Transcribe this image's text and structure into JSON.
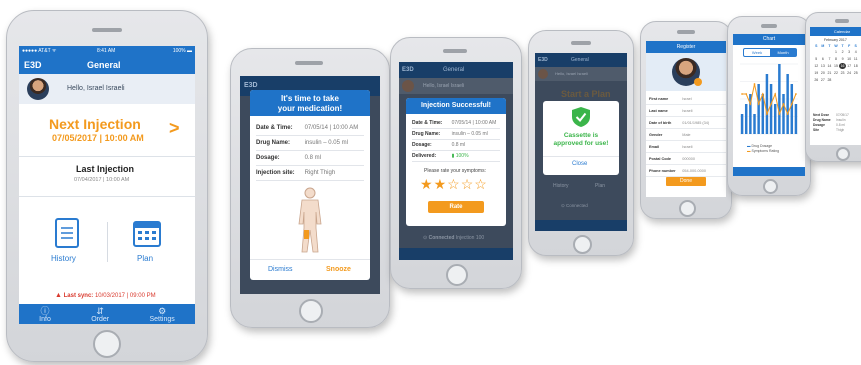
{
  "phone1": {
    "status": {
      "carrier": "●●●●● AT&T ᯤ",
      "time": "8:41 AM",
      "battery": "100% ▬"
    },
    "brand": "E3D",
    "title": "General",
    "greeting": "Hello, Israel Israeli",
    "next_label": "Next Injection",
    "next_datetime": "07/05/2017 | 10:00 AM",
    "last_label": "Last Injection",
    "last_datetime": "07/04/2017 | 10:00 AM",
    "history_label": "History",
    "plan_label": "Plan",
    "sync_label": "Last sync:",
    "sync_value": "10/03/2017 | 09:00 PM",
    "tabs": [
      "Info",
      "Order",
      "Settings"
    ]
  },
  "phone2": {
    "brand": "E3D",
    "title_line1": "It's time to take",
    "title_line2": "your medication!",
    "rows": [
      {
        "label": "Date & Time:",
        "value": "07/05/14 | 10:00 AM"
      },
      {
        "label": "Drug Name:",
        "value": "insulin – 0.05 ml"
      },
      {
        "label": "Dosage:",
        "value": "0.8 ml"
      },
      {
        "label": "Injection site:",
        "value": "Right Thigh"
      }
    ],
    "dismiss": "Dismiss",
    "snooze": "Snooze"
  },
  "phone3": {
    "brand": "E3D",
    "title": "General",
    "greeting": "Hello, Israel Israeli",
    "modal_title": "Injection Successful!",
    "rows": [
      {
        "label": "Date & Time:",
        "value": "07/05/14 | 10:00 AM"
      },
      {
        "label": "Drug Name:",
        "value": "insulin – 0.05 ml"
      },
      {
        "label": "Dosage:",
        "value": "0.8 ml"
      },
      {
        "label": "Delivered:",
        "value": "100%"
      }
    ],
    "rate_prompt": "Please rate your symptoms:",
    "rating": 2,
    "rating_max": 5,
    "rate_button": "Rate",
    "connected": "Connected",
    "connected_detail": "Injection 100"
  },
  "phone4": {
    "brand": "E3D",
    "title": "General",
    "greeting": "Hello, Israel Israeli",
    "bg_text": "Start a Plan",
    "modal_line1": "Cassette is",
    "modal_line2": "approved for use!",
    "close": "Close",
    "history": "History",
    "plan": "Plan",
    "connected": "Connected"
  },
  "phone5": {
    "title": "Register",
    "fields": [
      "First name",
      "Last name",
      "Date of birth",
      "Gender",
      "Email",
      "Postal Code",
      "Phone number"
    ],
    "values": [
      "Israel",
      "Israeli",
      "01/01/1985 (34)",
      "Male",
      "Israeli",
      "000000",
      "054-000-0000"
    ],
    "done": "Done"
  },
  "phone6": {
    "title": "Chart",
    "tabs": [
      "Week",
      "Month"
    ],
    "legend": [
      "Drug Dosage",
      "Symptoms Rating"
    ],
    "chart_data": {
      "type": "bar",
      "categories": [
        "1",
        "2",
        "3",
        "4",
        "5",
        "6",
        "7",
        "8",
        "9",
        "10",
        "11",
        "12",
        "13",
        "14"
      ],
      "series": [
        {
          "name": "Drug Dosage",
          "values": [
            2,
            3,
            4,
            2,
            5,
            4,
            6,
            5,
            3,
            7,
            4,
            6,
            5,
            3
          ]
        },
        {
          "name": "Symptoms Rating",
          "values": [
            4,
            4,
            3,
            5,
            3,
            4,
            2,
            3,
            4,
            2,
            3,
            2,
            3,
            4
          ]
        }
      ]
    }
  },
  "phone7": {
    "title": "Calendar",
    "month": "February 2017",
    "weekdays": [
      "S",
      "M",
      "T",
      "W",
      "T",
      "F",
      "S"
    ],
    "days": [
      "",
      "",
      "",
      "1",
      "2",
      "3",
      "4",
      "5",
      "6",
      "7",
      "8",
      "9",
      "10",
      "11",
      "12",
      "13",
      "14",
      "15",
      "16",
      "17",
      "18",
      "19",
      "20",
      "21",
      "22",
      "23",
      "24",
      "25",
      "26",
      "27",
      "28",
      "",
      "",
      "",
      "",
      ""
    ],
    "selected_day": "16",
    "details": [
      {
        "label": "Next Dose",
        "value": "07/05/17"
      },
      {
        "label": "Drug Name",
        "value": "Insulin"
      },
      {
        "label": "Dosage",
        "value": "0.8 ml"
      },
      {
        "label": "Site",
        "value": "Thigh"
      }
    ]
  },
  "colors": {
    "blue": "#1f73c8",
    "orange": "#f39a1e",
    "green": "#3bb54a",
    "alert_red": "#d9382c"
  }
}
